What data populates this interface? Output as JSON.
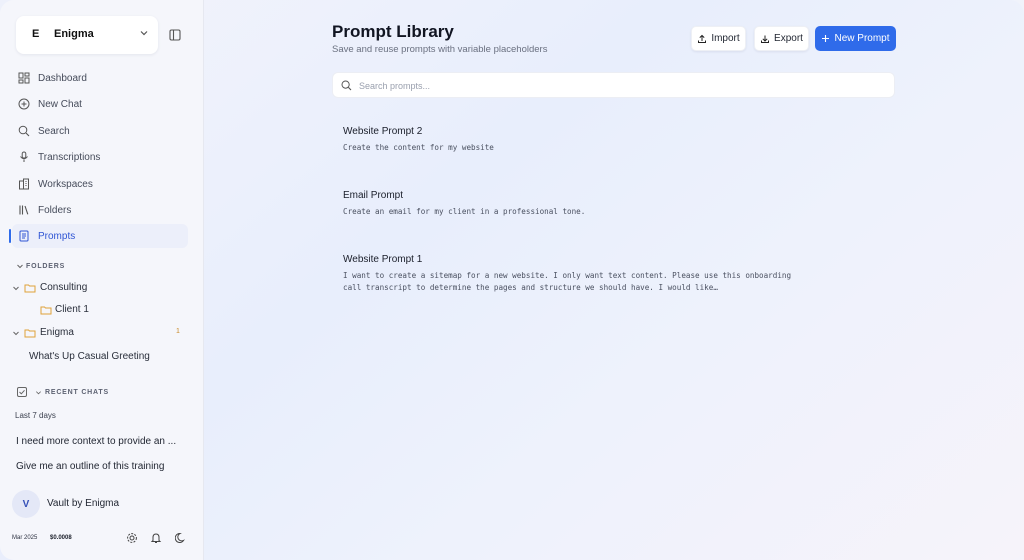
{
  "workspace": {
    "initial": "E",
    "name": "Enigma"
  },
  "nav": [
    {
      "label": "Dashboard",
      "icon": "dashboard-icon"
    },
    {
      "label": "New Chat",
      "icon": "plus-circle-icon"
    },
    {
      "label": "Search",
      "icon": "search-icon"
    },
    {
      "label": "Transcriptions",
      "icon": "microphone-icon"
    },
    {
      "label": "Workspaces",
      "icon": "building-icon"
    },
    {
      "label": "Folders",
      "icon": "library-icon"
    },
    {
      "label": "Prompts",
      "icon": "document-icon",
      "active": true
    }
  ],
  "folders": {
    "section_label": "FOLDERS",
    "items": [
      {
        "label": "Consulting"
      },
      {
        "label": "Client 1"
      },
      {
        "label": "Enigma",
        "count": "1"
      },
      {
        "label": "What's Up Casual Greeting"
      }
    ]
  },
  "recent": {
    "section_label": "RECENT CHATS",
    "group_label": "Last 7 days",
    "items": [
      {
        "label": "I need more context to provide an ..."
      },
      {
        "label": "Give me an outline of this training"
      }
    ]
  },
  "user": {
    "avatar_initial": "V",
    "name": "Vault by Enigma"
  },
  "footer": {
    "date": "Mar 2025",
    "cost": "$0.0008"
  },
  "header": {
    "title": "Prompt Library",
    "subtitle": "Save and reuse prompts with variable placeholders",
    "import_label": "Import",
    "export_label": "Export",
    "new_label": "New Prompt"
  },
  "search": {
    "placeholder": "Search prompts..."
  },
  "prompts": [
    {
      "title": "Website Prompt 2",
      "description": "Create the content for my website"
    },
    {
      "title": "Email Prompt",
      "description": "Create an email for my client in a professional tone."
    },
    {
      "title": "Website Prompt 1",
      "description": "I want to create a sitemap for a new website. I only want text content. Please use this onboarding call transcript to determine the pages and structure we should have. I would like…"
    }
  ],
  "colors": {
    "accent": "#2f6bea",
    "folder": "#e0a23a",
    "sidebar_bg": "#f5f6fb"
  }
}
